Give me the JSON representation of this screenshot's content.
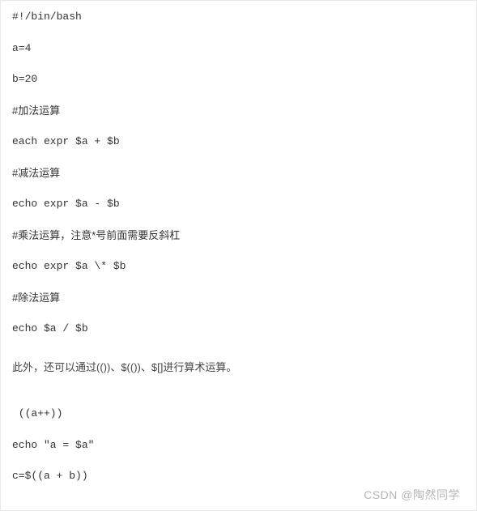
{
  "code": {
    "line1": "#!/bin/bash",
    "line2": "a=4",
    "line3": "b=20",
    "line4": "#加法运算",
    "line5": "each expr $a + $b",
    "line6": "#减法运算",
    "line7": "echo expr $a - $b",
    "line8": "#乘法运算，注意*号前面需要反斜杠",
    "line9": "echo expr $a \\* $b",
    "line10": "#除法运算",
    "line11": "echo $a / $b"
  },
  "prose": {
    "text": "此外，还可以通过(())、$(())、$[]进行算术运算。"
  },
  "code2": {
    "line1": " ((a++))",
    "line2": "echo \"a = $a\"",
    "line3": "c=$((a + b))"
  },
  "watermark": "CSDN @陶然同学"
}
